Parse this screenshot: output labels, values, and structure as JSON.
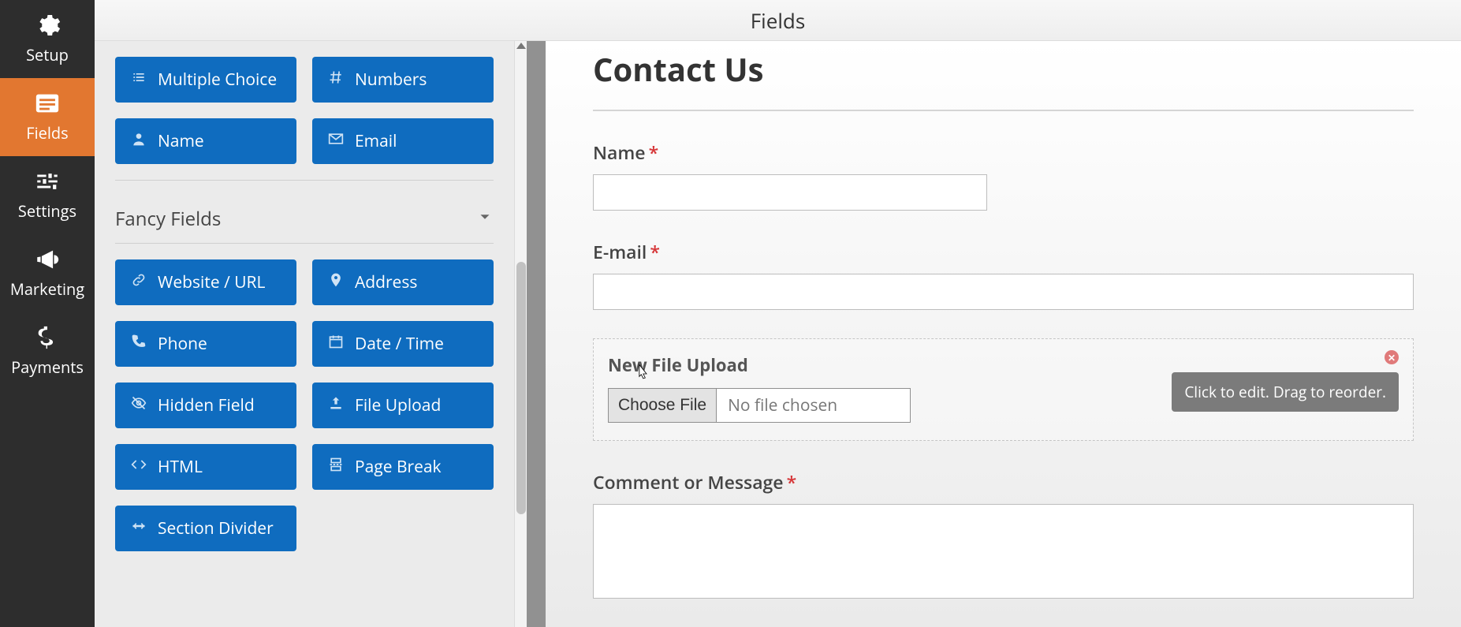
{
  "sidebar": {
    "items": [
      {
        "id": "setup",
        "label": "Setup",
        "icon": "gear-icon"
      },
      {
        "id": "fields",
        "label": "Fields",
        "icon": "form-icon",
        "active": true
      },
      {
        "id": "settings",
        "label": "Settings",
        "icon": "sliders-icon"
      },
      {
        "id": "marketing",
        "label": "Marketing",
        "icon": "bullhorn-icon"
      },
      {
        "id": "payments",
        "label": "Payments",
        "icon": "dollar-icon"
      }
    ]
  },
  "header": {
    "title": "Fields"
  },
  "palette": {
    "row1": [
      {
        "id": "multiple-choice",
        "label": "Multiple Choice",
        "icon": "list-icon"
      },
      {
        "id": "numbers",
        "label": "Numbers",
        "icon": "hash-icon"
      }
    ],
    "row2": [
      {
        "id": "name",
        "label": "Name",
        "icon": "person-icon"
      },
      {
        "id": "email",
        "label": "Email",
        "icon": "envelope-icon"
      }
    ],
    "section_title": "Fancy Fields",
    "fancy": [
      {
        "id": "website",
        "label": "Website / URL",
        "icon": "link-icon"
      },
      {
        "id": "address",
        "label": "Address",
        "icon": "marker-icon"
      },
      {
        "id": "phone",
        "label": "Phone",
        "icon": "phone-icon"
      },
      {
        "id": "datetime",
        "label": "Date / Time",
        "icon": "calendar-icon"
      },
      {
        "id": "hidden",
        "label": "Hidden Field",
        "icon": "eye-slash-icon"
      },
      {
        "id": "fileupload",
        "label": "File Upload",
        "icon": "upload-icon"
      },
      {
        "id": "html",
        "label": "HTML",
        "icon": "code-icon"
      },
      {
        "id": "pagebreak",
        "label": "Page Break",
        "icon": "pagebreak-icon"
      },
      {
        "id": "section-divider",
        "label": "Section Divider",
        "icon": "hr-icon"
      }
    ]
  },
  "preview": {
    "form_title": "Contact Us",
    "name_label": "Name",
    "email_label": "E-mail",
    "upload_label": "New File Upload",
    "choose_btn": "Choose File",
    "no_file": "No file chosen",
    "tooltip": "Click to edit. Drag to reorder.",
    "message_label": "Comment or Message"
  }
}
